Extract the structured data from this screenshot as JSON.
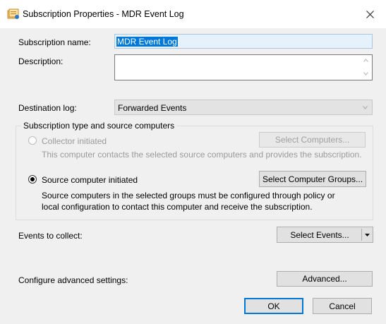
{
  "window": {
    "title": "Subscription Properties - MDR Event Log",
    "close_glyph": "✕"
  },
  "fields": {
    "subscription_name_label": "Subscription name:",
    "subscription_name_value": "MDR Event Log",
    "description_label": "Description:",
    "description_value": "",
    "destination_log_label": "Destination log:",
    "destination_log_value": "Forwarded Events"
  },
  "group": {
    "legend": "Subscription type and source computers",
    "collector_label": "Collector initiated",
    "collector_desc": "This computer contacts the selected source computers and provides the subscription.",
    "collector_selected": false,
    "select_computers_label": "Select Computers...",
    "source_label": "Source computer initiated",
    "source_selected": true,
    "source_desc_line1": "Source computers in the selected groups must be configured through policy or",
    "source_desc_line2": "local configuration to contact this computer and receive the subscription.",
    "select_groups_label": "Select Computer Groups..."
  },
  "events": {
    "label": "Events to collect:",
    "button_label": "Select Events..."
  },
  "advanced": {
    "label": "Configure advanced settings:",
    "button_label": "Advanced..."
  },
  "footer": {
    "ok_label": "OK",
    "cancel_label": "Cancel"
  },
  "colors": {
    "accent": "#0078d7",
    "dialog_bg": "#f0f0f0"
  },
  "icons": [
    "subscription-icon",
    "close-icon",
    "chevron-down-icon",
    "dropdown-arrow-icon",
    "scroll-up-icon",
    "scroll-down-icon"
  ]
}
